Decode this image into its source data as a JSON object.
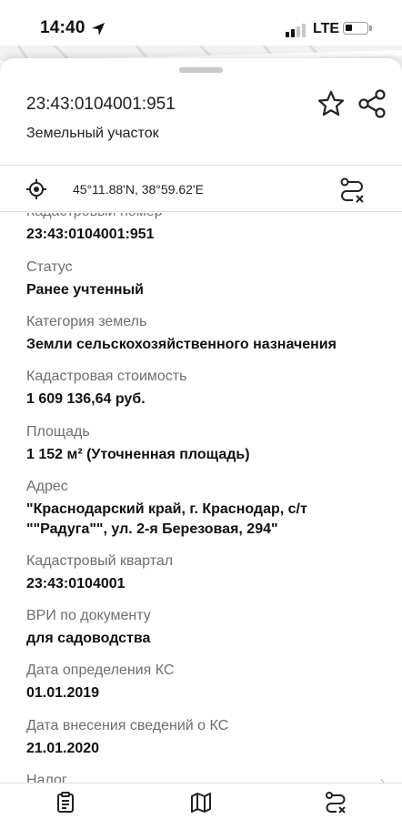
{
  "status_bar": {
    "time": "14:40",
    "network": "LTE"
  },
  "header": {
    "title": "23:43:0104001:951",
    "subtitle": "Земельный участок",
    "icons": [
      "star-icon",
      "share-icon"
    ]
  },
  "coordinates": {
    "text": "45°11.88'N, 38°59.62'E",
    "icons": [
      "crosshair-icon",
      "route-icon"
    ]
  },
  "fields": [
    {
      "label": "Кадастровый номер",
      "value": "23:43:0104001:951"
    },
    {
      "label": "Статус",
      "value": "Ранее учтенный"
    },
    {
      "label": "Категория земель",
      "value": "Земли сельскохозяйственного назначения"
    },
    {
      "label": "Кадастровая стоимость",
      "value": "1 609 136,64 руб."
    },
    {
      "label": "Площадь",
      "value": "1 152 м² (Уточненная площадь)"
    },
    {
      "label": "Адрес",
      "value": "\"Краснодарский край, г. Краснодар, с/т \"\"Радуга\"\", ул. 2-я Березовая, 294\""
    },
    {
      "label": "Кадастровый квартал",
      "value": "23:43:0104001"
    },
    {
      "label": "ВРИ по документу",
      "value": "для садоводства"
    },
    {
      "label": "Дата определения КС",
      "value": "01.01.2019"
    },
    {
      "label": "Дата внесения сведений о КС",
      "value": "21.01.2020"
    },
    {
      "label": "Налог",
      "value": ""
    }
  ],
  "tabbar": {
    "icons": [
      "clipboard-icon",
      "map-icon",
      "route-icon"
    ]
  }
}
